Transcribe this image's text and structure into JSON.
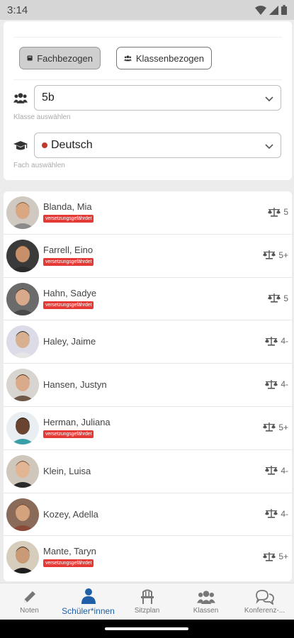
{
  "status_bar": {
    "time": "3:14"
  },
  "filter": {
    "mode_buttons": [
      {
        "label": "Fachbezogen",
        "active": true
      },
      {
        "label": "Klassenbezogen",
        "active": false
      }
    ],
    "class_select": {
      "value": "5b",
      "hint": "Klasse auswählen",
      "icon": "users-icon"
    },
    "subject_select": {
      "value": "Deutsch",
      "hint": "Fach auswählen",
      "icon": "graduation-cap-icon",
      "dot_color": "#c0392b"
    }
  },
  "students": [
    {
      "name": "Blanda, Mia",
      "badge": "versetzungsgefährdet",
      "grade": "5"
    },
    {
      "name": "Farrell, Eino",
      "badge": "versetzungsgefährdet",
      "grade": "5+"
    },
    {
      "name": "Hahn, Sadye",
      "badge": "versetzungsgefährdet",
      "grade": "5"
    },
    {
      "name": "Haley, Jaime",
      "badge": "",
      "grade": "4-"
    },
    {
      "name": "Hansen, Justyn",
      "badge": "",
      "grade": "4-"
    },
    {
      "name": "Herman, Juliana",
      "badge": "versetzungsgefährdet",
      "grade": "5+"
    },
    {
      "name": "Klein, Luisa",
      "badge": "",
      "grade": "4-"
    },
    {
      "name": "Kozey, Adella",
      "badge": "",
      "grade": "4-"
    },
    {
      "name": "Mante, Taryn",
      "badge": "versetzungsgefährdet",
      "grade": "5+"
    }
  ],
  "bottom_nav": [
    {
      "label": "Noten",
      "icon": "pencil-icon",
      "active": false
    },
    {
      "label": "Schüler*innen",
      "icon": "person-icon",
      "active": true
    },
    {
      "label": "Sitzplan",
      "icon": "chair-icon",
      "active": false
    },
    {
      "label": "Klassen",
      "icon": "group-icon",
      "active": false
    },
    {
      "label": "Konferenz-...",
      "icon": "chat-icon",
      "active": false
    }
  ],
  "colors": {
    "accent": "#1f5fa8",
    "badge": "#e53935"
  }
}
